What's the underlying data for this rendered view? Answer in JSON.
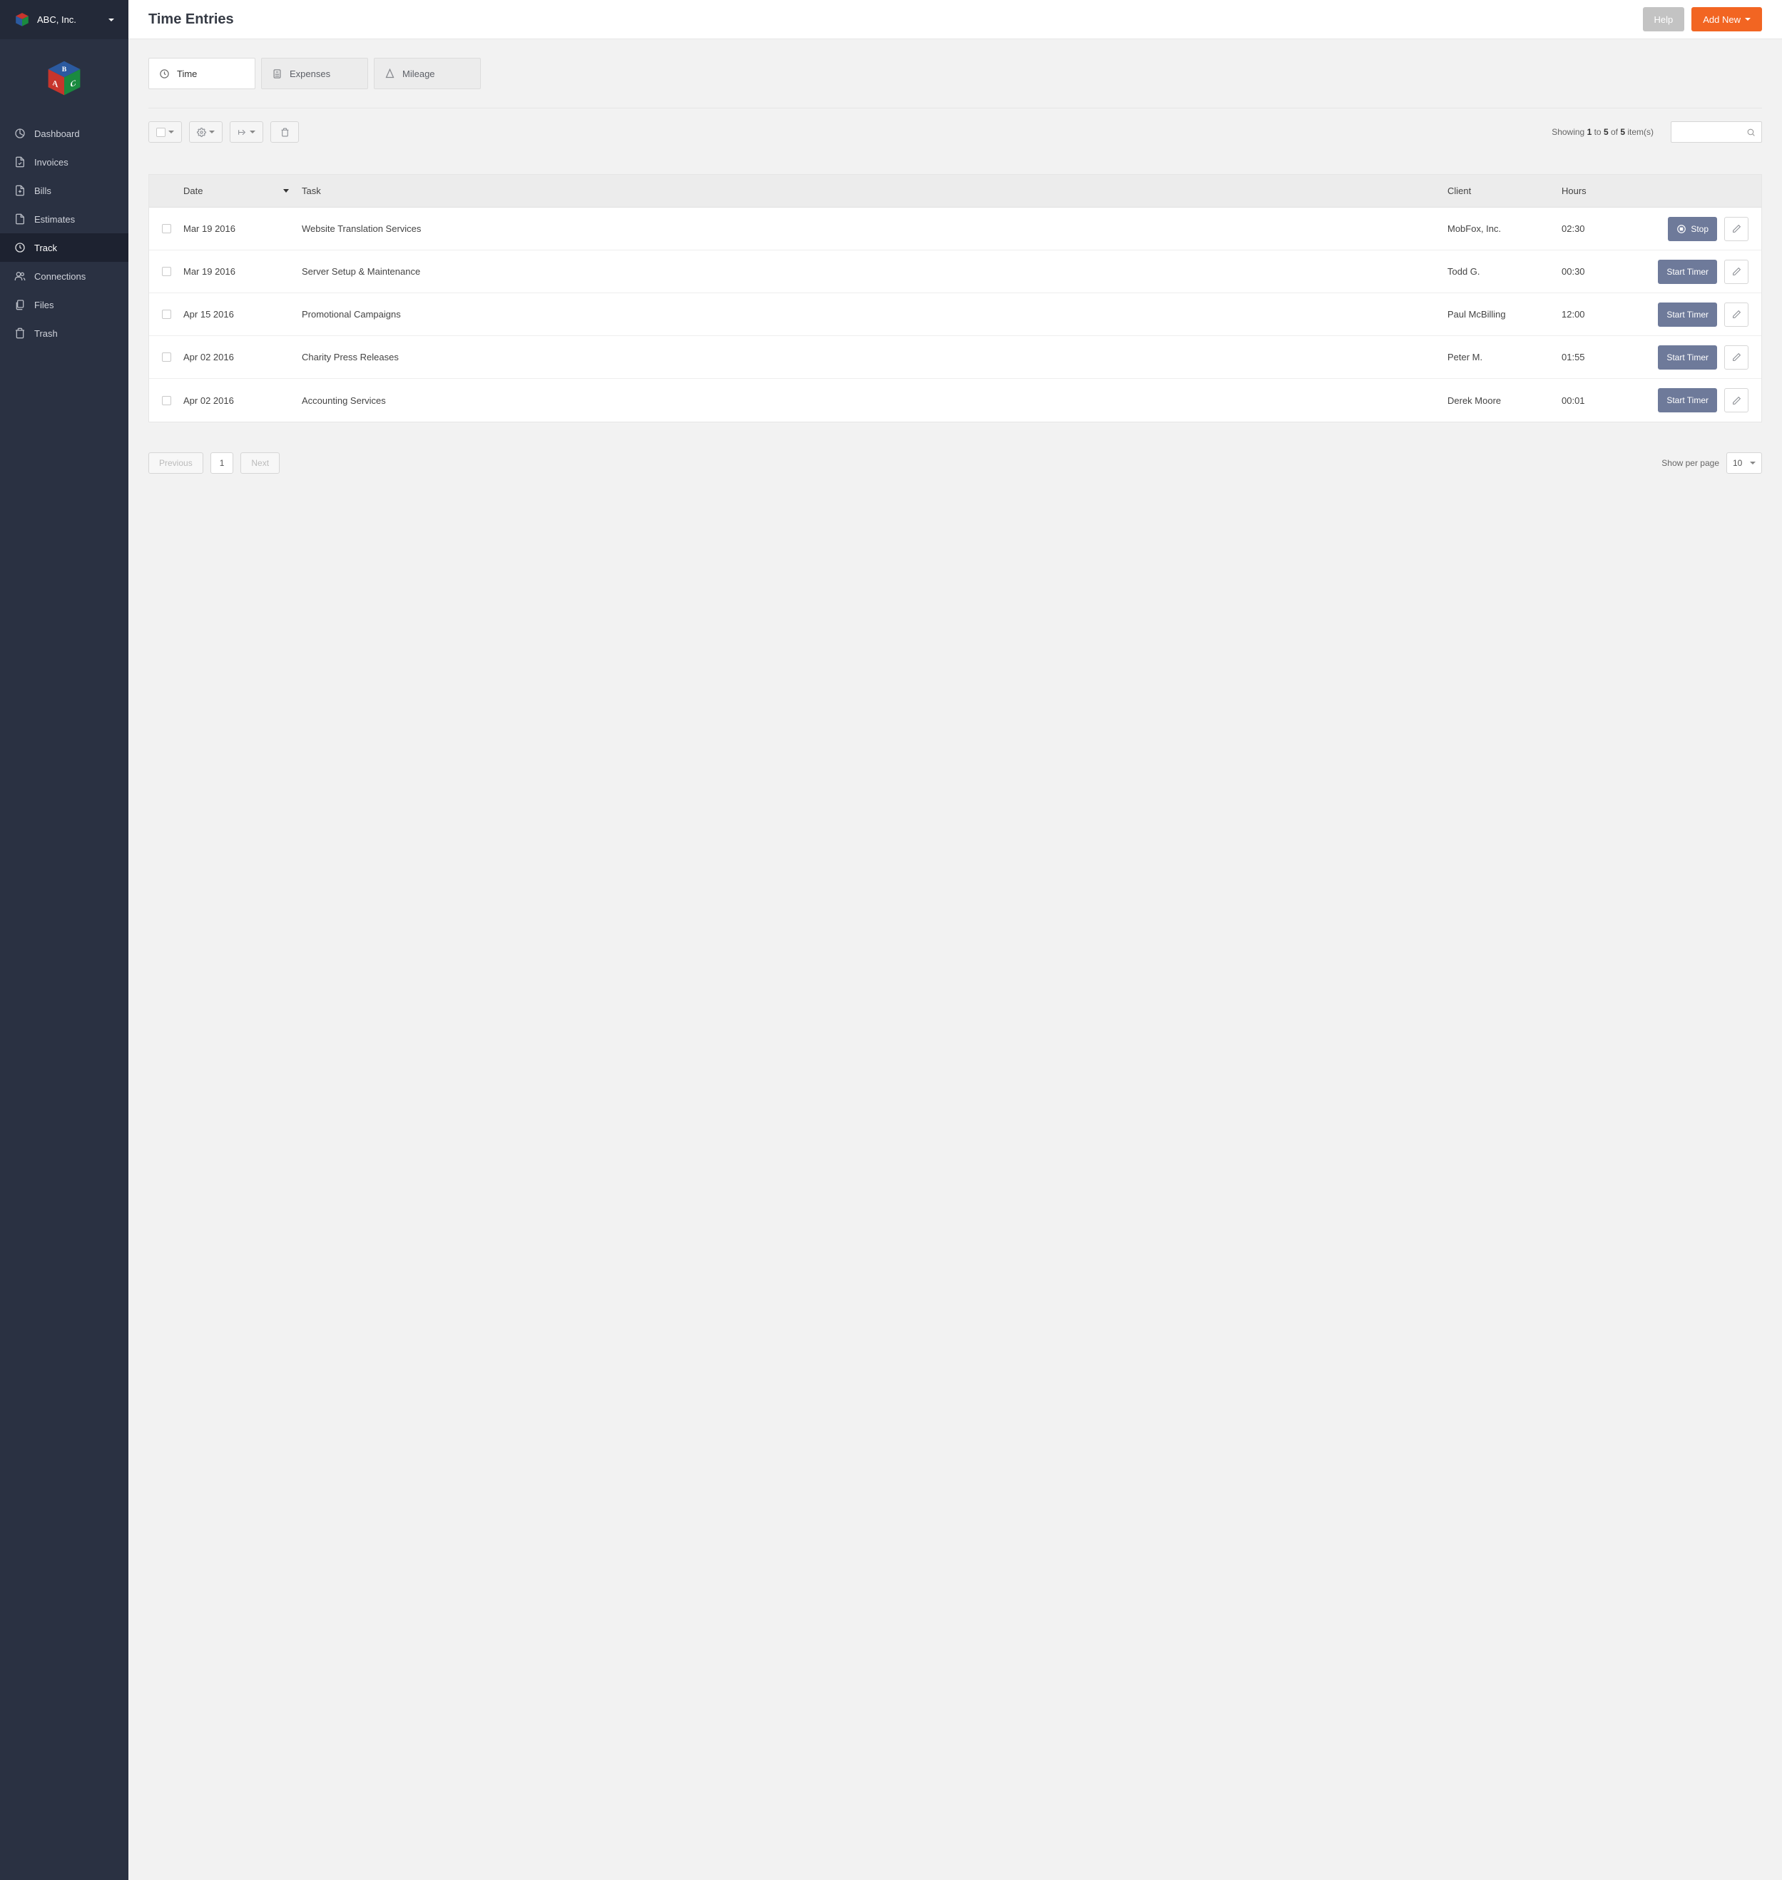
{
  "company": {
    "name": "ABC, Inc."
  },
  "header": {
    "title": "Time Entries",
    "help": "Help",
    "add_new": "Add New"
  },
  "sidebar": {
    "items": [
      {
        "label": "Dashboard",
        "icon": "chart-pie-icon"
      },
      {
        "label": "Invoices",
        "icon": "document-icon"
      },
      {
        "label": "Bills",
        "icon": "plus-document-icon"
      },
      {
        "label": "Estimates",
        "icon": "document-blank-icon"
      },
      {
        "label": "Track",
        "icon": "clock-icon",
        "active": true
      },
      {
        "label": "Connections",
        "icon": "users-icon"
      },
      {
        "label": "Files",
        "icon": "files-icon"
      },
      {
        "label": "Trash",
        "icon": "trash-icon"
      }
    ]
  },
  "tabs": [
    {
      "label": "Time",
      "icon": "clock-icon",
      "active": true
    },
    {
      "label": "Expenses",
      "icon": "calculator-icon"
    },
    {
      "label": "Mileage",
      "icon": "location-icon"
    }
  ],
  "showing": {
    "prefix": "Showing ",
    "from": "1",
    "mid1": " to ",
    "to": "5",
    "mid2": " of ",
    "total": "5",
    "suffix": " item(s)"
  },
  "columns": {
    "date": "Date",
    "task": "Task",
    "client": "Client",
    "hours": "Hours"
  },
  "rows": [
    {
      "date": "Mar 19 2016",
      "task": "Website Translation Services",
      "client": "MobFox, Inc.",
      "hours": "02:30",
      "timer": "Stop",
      "running": true
    },
    {
      "date": "Mar 19 2016",
      "task": "Server Setup & Maintenance",
      "client": "Todd G.",
      "hours": "00:30",
      "timer": "Start Timer",
      "running": false
    },
    {
      "date": "Apr 15 2016",
      "task": "Promotional Campaigns",
      "client": "Paul McBilling",
      "hours": "12:00",
      "timer": "Start Timer",
      "running": false
    },
    {
      "date": "Apr 02 2016",
      "task": "Charity Press Releases",
      "client": "Peter M.",
      "hours": "01:55",
      "timer": "Start Timer",
      "running": false
    },
    {
      "date": "Apr 02 2016",
      "task": "Accounting Services",
      "client": "Derek Moore",
      "hours": "00:01",
      "timer": "Start Timer",
      "running": false
    }
  ],
  "pagination": {
    "prev": "Previous",
    "page": "1",
    "next": "Next",
    "perpage_label": "Show per page",
    "perpage_value": "10"
  }
}
